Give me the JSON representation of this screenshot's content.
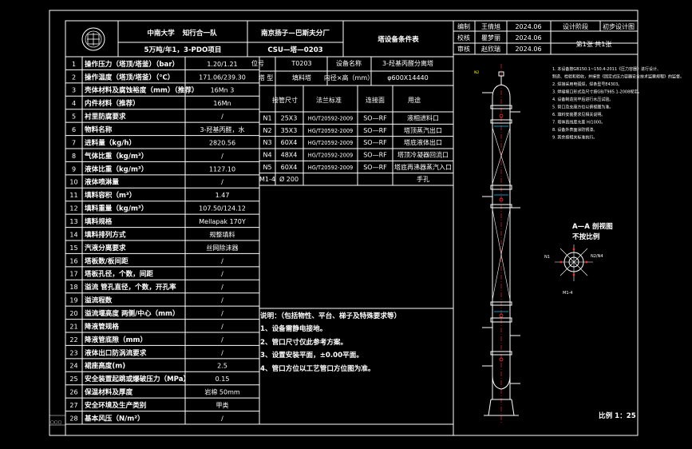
{
  "header": {
    "university": "中南大学",
    "team": "知行合一队",
    "company": "南京扬子—巴斯夫分厂",
    "project": "5万吨/年1，3-PDO项目",
    "doc_type": "塔设备条件表",
    "drawing_no": "CSU—塔—0203",
    "sign_roles": [
      "编制",
      "校核",
      "审核"
    ],
    "sign_names": [
      "王倩旭",
      "瞿梦丽",
      "赵欣瑞"
    ],
    "sign_dates": [
      "2024.06",
      "2024.06",
      "2024.06"
    ],
    "stage_label": "设计阶段",
    "stage_value": "初步设计图",
    "sheet_info": "第1张   共1张"
  },
  "params": [
    {
      "no": "1",
      "name": "操作压力（塔顶/塔釜）（bar）",
      "value": "1.20/1.21"
    },
    {
      "no": "2",
      "name": "操作温度（塔顶/塔釜）（℃）",
      "value": "171.06/239.30"
    },
    {
      "no": "3",
      "name": "壳体材料及腐蚀裕度（mm）（推荐）",
      "value": "16Mn 3"
    },
    {
      "no": "4",
      "name": "内件材料（推荐）",
      "value": "16Mn"
    },
    {
      "no": "5",
      "name": "衬里防腐要求",
      "value": "/"
    },
    {
      "no": "6",
      "name": "物料名称",
      "value": "3-羟基丙醛，水"
    },
    {
      "no": "7",
      "name": "进料量（kg/h）",
      "value": "2820.56"
    },
    {
      "no": "8",
      "name": "气体比重（kg/m³）",
      "value": "/"
    },
    {
      "no": "9",
      "name": "液体比重（kg/m³）",
      "value": "1127.10"
    },
    {
      "no": "10",
      "name": "液体喷淋量",
      "value": "/"
    },
    {
      "no": "11",
      "name": "填料容积（m³）",
      "value": "1.47"
    },
    {
      "no": "12",
      "name": "填料重量（kg/m³）",
      "value": "107.50/124.12"
    },
    {
      "no": "13",
      "name": "填料规格",
      "value": "Mellapak 170Y"
    },
    {
      "no": "14",
      "name": "填料排列方式",
      "value": "规整填料"
    },
    {
      "no": "15",
      "name": "汽液分离要求",
      "value": "丝网除沫器"
    },
    {
      "no": "16",
      "name": "塔板数/板间距",
      "value": "/"
    },
    {
      "no": "17",
      "name": "塔板孔径，个数，间距",
      "value": "/"
    },
    {
      "no": "18",
      "name": "溢流 管孔直径，个数，开孔率",
      "value": "/"
    },
    {
      "no": "19",
      "name": "溢流程数",
      "value": "/"
    },
    {
      "no": "20",
      "name": "溢流堰高度 两侧/中心（mm）",
      "value": "/"
    },
    {
      "no": "21",
      "name": "降液管规格",
      "value": "/"
    },
    {
      "no": "22",
      "name": "降液管底隙（mm）",
      "value": "/"
    },
    {
      "no": "23",
      "name": "液体出口防涡流要求",
      "value": "/"
    },
    {
      "no": "24",
      "name": "裙座高度(m)",
      "value": "2.5"
    },
    {
      "no": "25",
      "name": "安全装置起跳或爆破压力（MPa）",
      "value": "0.15"
    },
    {
      "no": "26",
      "name": "保温材料及厚度",
      "value": "岩棉 50mm"
    },
    {
      "no": "27",
      "name": "安全环境及生产类别",
      "value": "甲类"
    },
    {
      "no": "28",
      "name": "基本风压（N/m²）",
      "value": "/"
    }
  ],
  "equipment": {
    "pos_label": "位号",
    "pos_value": "T0203",
    "name_label": "设备名称",
    "name_value": "3-羟基丙醛分离塔",
    "type_label": "塔 型",
    "type_value": "填料塔",
    "dia_label": "内径×高（mm）",
    "dia_value": "φ600X14440"
  },
  "nozzle_headers": [
    "接管尺寸",
    "法兰标准",
    "连接面",
    "用途"
  ],
  "nozzles": [
    {
      "id": "N1",
      "size": "25X3",
      "std": "HG/T20592-2009",
      "face": "SO—RF",
      "use": "液相进料口"
    },
    {
      "id": "N2",
      "size": "35X3",
      "std": "HG/T20592-2009",
      "face": "SO—RF",
      "use": "塔顶蒸汽出口"
    },
    {
      "id": "N3",
      "size": "60X4",
      "std": "HG/T20592-2009",
      "face": "SO—RF",
      "use": "塔底液体出口"
    },
    {
      "id": "N4",
      "size": "48X4",
      "std": "HG/T20592-2009",
      "face": "SO—RF",
      "use": "塔顶冷凝器回流口"
    },
    {
      "id": "N5",
      "size": "60X4",
      "std": "HG/T20592-2009",
      "face": "SO—RF",
      "use": "塔底再沸器蒸汽入口"
    },
    {
      "id": "M1-4",
      "size": "Ø 200",
      "std": "",
      "face": "",
      "use": "手孔"
    }
  ],
  "notes": {
    "title": "说明：（包括物性、平台、梯子及特殊要求等）",
    "items": [
      "1、设备需静电接地。",
      "2、管口尺寸仅此参考方案。",
      "3、设置安装平面，±0.00平面。",
      "4、管口方位以工艺管口方位图为准。"
    ]
  },
  "drawing": {
    "view_label": "A—A 剖视图",
    "view_sub": "不按比例",
    "scale": "比例 1：25",
    "right_notes": [
      "1. 本设备按GB150.1~150.4-2011《压力容器》进行设计、",
      "制造、检验和验收，并接受《固定式压力容器安全技术监察规程》的监督。",
      "2. 焊接采用电弧焊，焊条型号E4303。",
      "3. 焊缝坡口形式及尺寸按GB/T985.1-2008规定。",
      "4. 设备制造完毕后进行水压试验。",
      "5. 管口及支座方位以俯视图为准。",
      "6. 填料安装要求见相关说明。",
      "7. 塔体直线度允差 H/1000。",
      "8. 设备外表面涂防锈漆。",
      "9. 其余按相关标准执行。"
    ]
  },
  "colors": {
    "background": "#000000",
    "line": "#ffffff",
    "cyan": "#00c8ff",
    "red": "#ff3030",
    "yellow": "#ffff00",
    "window_frame": "#c9ccd1"
  }
}
